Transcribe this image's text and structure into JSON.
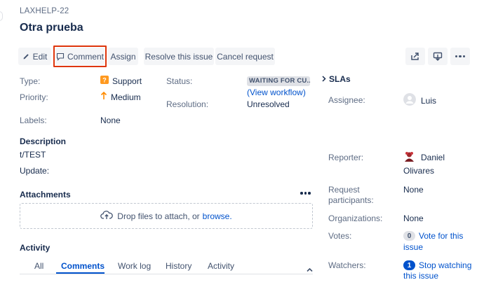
{
  "issue": {
    "key": "LAXHELP-22",
    "title": "Otra prueba"
  },
  "toolbar": {
    "edit": "Edit",
    "comment": "Comment",
    "assign": "Assign",
    "resolve": "Resolve this issue",
    "cancel": "Cancel request",
    "icons": [
      "share-icon",
      "export-icon",
      "more-icon"
    ]
  },
  "details": {
    "type_label": "Type:",
    "type_value": "Support",
    "priority_label": "Priority:",
    "priority_value": "Medium",
    "labels_label": "Labels:",
    "labels_value": "None",
    "status_label": "Status:",
    "status_value": "WAITING FOR CU...",
    "view_workflow": "View workflow",
    "resolution_label": "Resolution:",
    "resolution_value": "Unresolved"
  },
  "description": {
    "title": "Description",
    "line1": "t/TEST",
    "line2": "Update:"
  },
  "attachments": {
    "title": "Attachments",
    "drop_text": "Drop files to attach, or",
    "browse": "browse."
  },
  "activity": {
    "title": "Activity",
    "tabs": [
      "All",
      "Comments",
      "Work log",
      "History",
      "Activity"
    ],
    "active_tab": "Comments"
  },
  "sidebar": {
    "slas_title": "SLAs",
    "assignee_label": "Assignee:",
    "assignee_value": "Luis",
    "reporter_label": "Reporter:",
    "reporter_first": "Daniel",
    "reporter_last": "Olivares",
    "request_participants_label_1": "Request",
    "request_participants_label_2": "participants:",
    "request_participants_value": "None",
    "organizations_label": "Organizations:",
    "organizations_value": "None",
    "votes_label": "Votes:",
    "votes_count": "0",
    "votes_link_1": "Vote for this",
    "votes_link_2": "issue",
    "watchers_label": "Watchers:",
    "watchers_count": "1",
    "watchers_link_1": "Stop watching",
    "watchers_link_2": "this issue"
  },
  "colors": {
    "link": "#0052CC",
    "highlight": "#DE350B",
    "support_icon": "#FF991F",
    "priority_icon": "#FF8B00"
  }
}
